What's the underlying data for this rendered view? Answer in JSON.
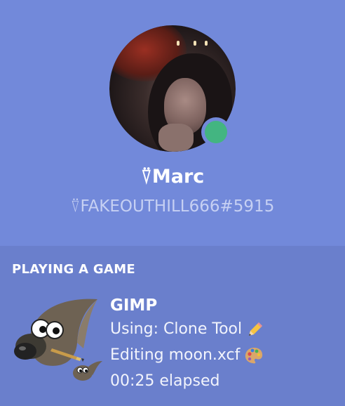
{
  "profile": {
    "display_name": "Marc",
    "name_glyph": "⍢",
    "tag": "⍢FAKEOUTHILL666#5915",
    "status": "online",
    "status_color": "#43b581"
  },
  "activity": {
    "section_title": "PLAYING A GAME",
    "game_name": "GIMP",
    "details": "Using: Clone Tool",
    "state": "Editing moon.xcf",
    "elapsed": "00:25 elapsed",
    "details_emoji": "pencil-icon",
    "state_emoji": "palette-icon",
    "game_icon": "gimp-wilber-icon"
  },
  "colors": {
    "background": "#7289da",
    "activity_background": "#6a7fcc",
    "text": "#ffffff",
    "muted_text": "#c6d0f3"
  }
}
